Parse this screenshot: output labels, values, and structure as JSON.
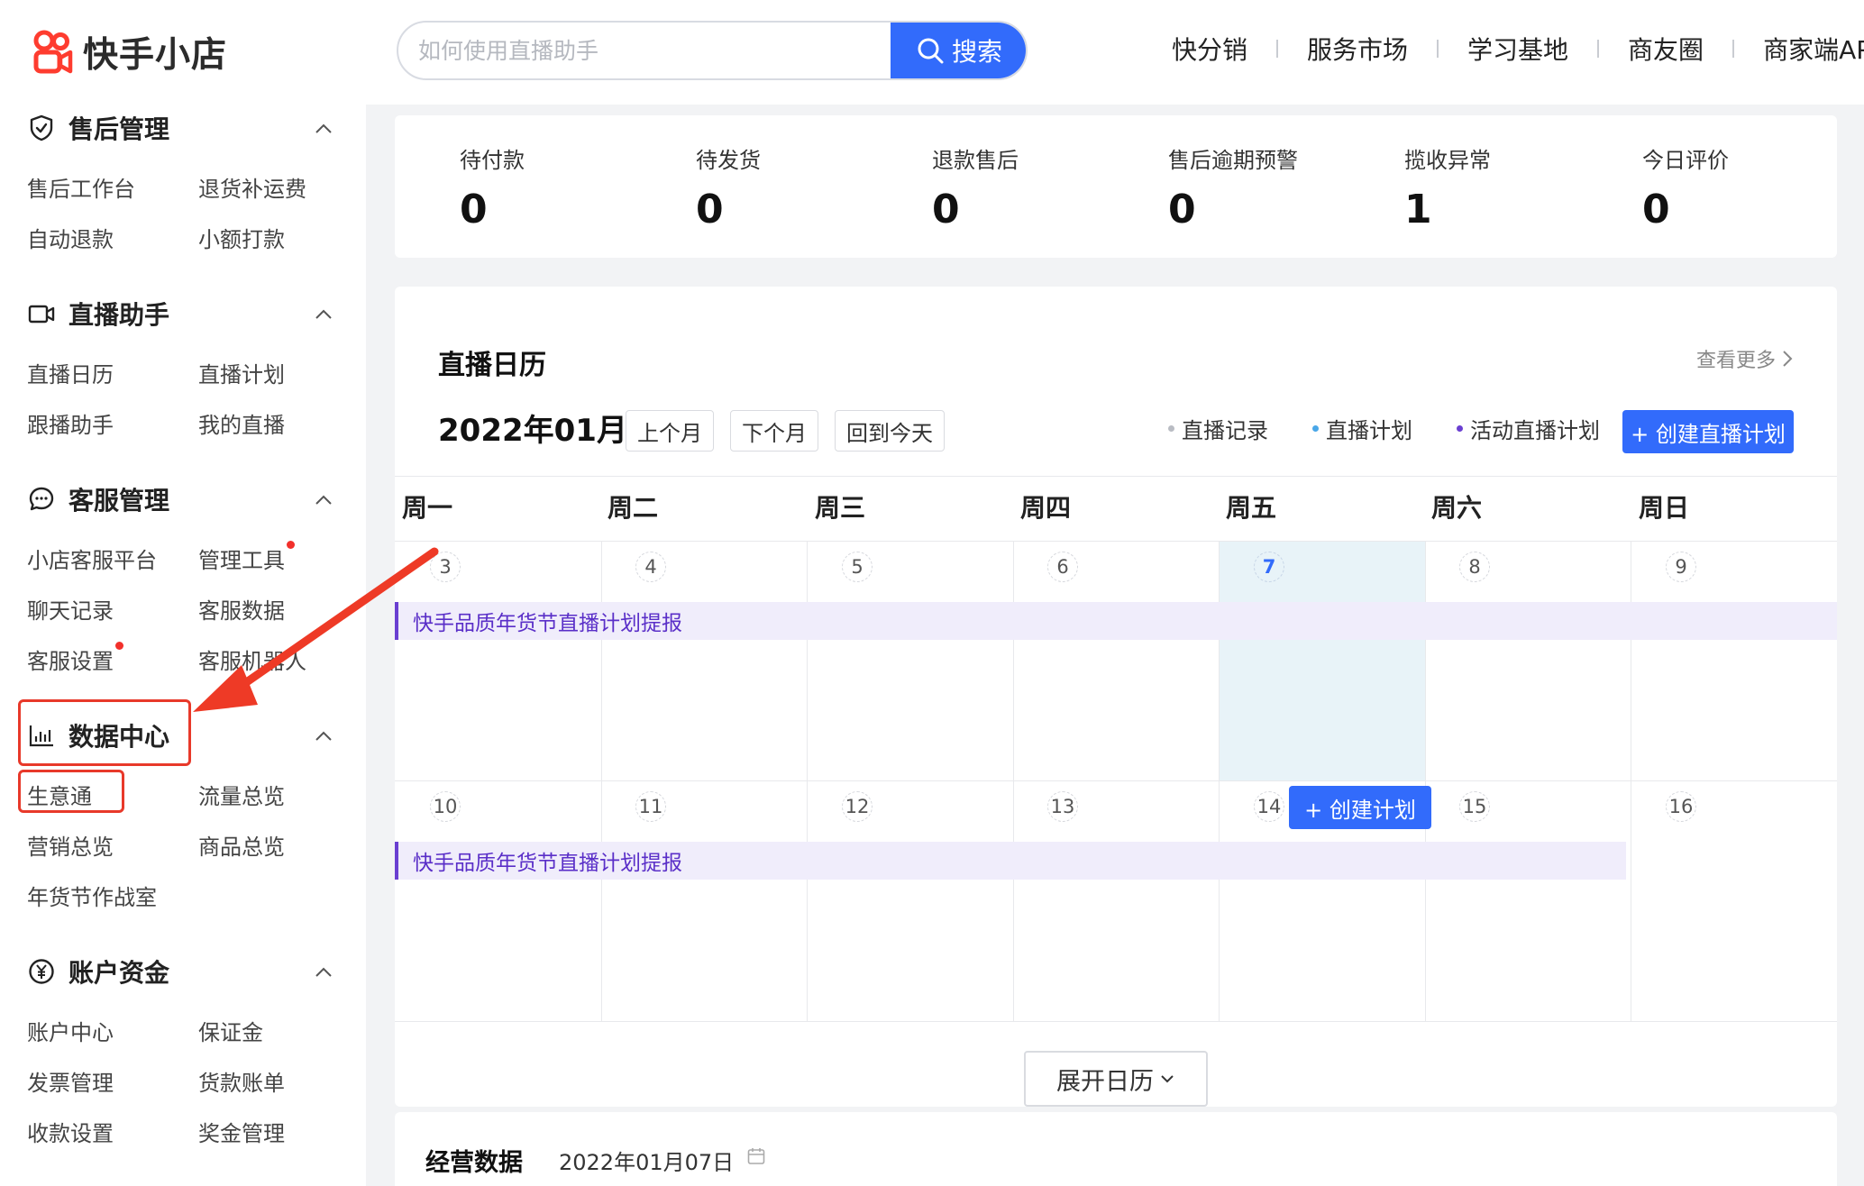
{
  "header": {
    "logo_text": "快手小店",
    "search_placeholder": "如何使用直播助手",
    "search_button": "搜索",
    "nav": [
      "快分销",
      "服务市场",
      "学习基地",
      "商友圈",
      "商家端AP"
    ]
  },
  "sidebar": {
    "sections": [
      {
        "title": "售后管理",
        "icon": "shield-check-icon",
        "links": [
          "售后工作台",
          "退货补运费",
          "自动退款",
          "小额打款"
        ]
      },
      {
        "title": "直播助手",
        "icon": "video-camera-icon",
        "links": [
          "直播日历",
          "直播计划",
          "跟播助手",
          "我的直播"
        ]
      },
      {
        "title": "客服管理",
        "icon": "chat-bubble-icon",
        "links": [
          "小店客服平台",
          "管理工具",
          "聊天记录",
          "客服数据",
          "客服设置",
          "客服机器人"
        ]
      },
      {
        "title": "数据中心",
        "icon": "bar-chart-icon",
        "links": [
          "生意通",
          "流量总览",
          "营销总览",
          "商品总览",
          "年货节作战室"
        ]
      },
      {
        "title": "账户资金",
        "icon": "yen-coin-icon",
        "links": [
          "账户中心",
          "保证金",
          "发票管理",
          "货款账单",
          "收款设置",
          "奖金管理"
        ]
      }
    ]
  },
  "stats": [
    {
      "label": "待付款",
      "value": "0"
    },
    {
      "label": "待发货",
      "value": "0"
    },
    {
      "label": "退款售后",
      "value": "0"
    },
    {
      "label": "售后逾期预警",
      "value": "0"
    },
    {
      "label": "揽收异常",
      "value": "1"
    },
    {
      "label": "今日评价",
      "value": "0"
    }
  ],
  "calendar": {
    "title": "直播日历",
    "more": "查看更多",
    "month": "2022年01月",
    "prev_month": "上个月",
    "next_month": "下个月",
    "today_btn": "回到今天",
    "legend": [
      {
        "label": "直播记录",
        "color": "#b9bcc3"
      },
      {
        "label": "直播计划",
        "color": "#4aa7e8"
      },
      {
        "label": "活动直播计划",
        "color": "#6a3fd1"
      }
    ],
    "create_live_plan": "+ 创建直播计划",
    "weekdays": [
      "周一",
      "周二",
      "周三",
      "周四",
      "周五",
      "周六",
      "周日"
    ],
    "week1_days": [
      "3",
      "4",
      "5",
      "6",
      "7",
      "8",
      "9"
    ],
    "week2_days": [
      "10",
      "11",
      "12",
      "13",
      "14",
      "15",
      "16"
    ],
    "today": "7",
    "event_week1": "快手品质年货节直播计划提报",
    "event_week2": "快手品质年货节直播计划提报",
    "create_plan": "+ 创建计划",
    "expand": "展开日历"
  },
  "business": {
    "title": "经营数据",
    "date": "2022年01月07日"
  },
  "colors": {
    "primary": "#326bfb",
    "highlight_red": "#e8392a",
    "event_purple": "#6a3fd1",
    "today_bg": "#e8f3f8"
  }
}
